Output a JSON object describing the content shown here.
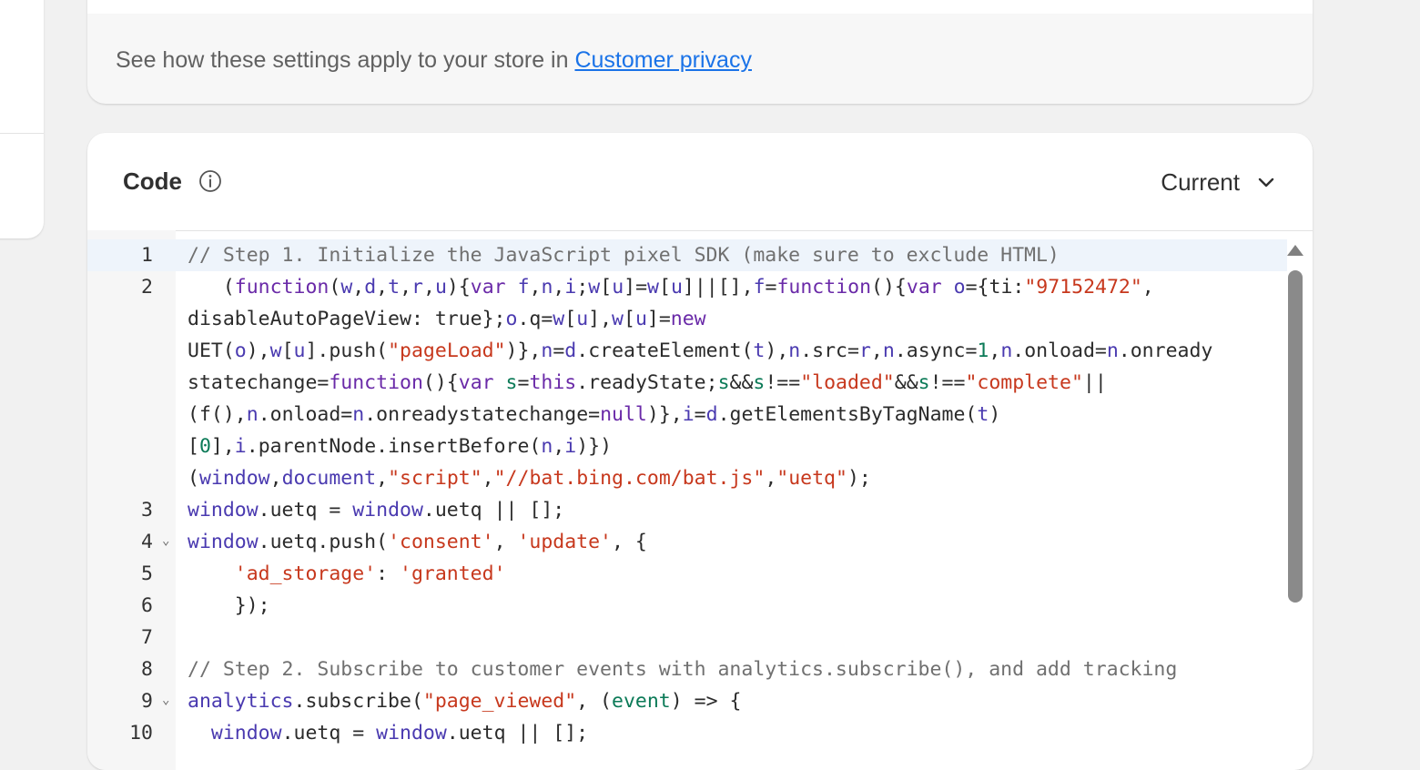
{
  "privacy": {
    "text": "See how these settings apply to your store in ",
    "link": "Customer privacy"
  },
  "code_card": {
    "title": "Code",
    "version": "Current"
  },
  "colors": {
    "link": "#1a73e8",
    "string": "#c7381d",
    "keyword": "#6a2aa8",
    "comment": "#707070"
  },
  "code_lines": [
    {
      "n": "1",
      "fold": false,
      "tokens": [
        [
          "c",
          "// Step 1. Initialize the JavaScript pixel SDK (make sure to exclude HTML)"
        ]
      ]
    },
    {
      "n": "2",
      "fold": false,
      "tokens": [
        [
          "p",
          "   ("
        ],
        [
          "k",
          "function"
        ],
        [
          "p",
          "("
        ],
        [
          "v",
          "w"
        ],
        [
          "p",
          ","
        ],
        [
          "v",
          "d"
        ],
        [
          "p",
          ","
        ],
        [
          "v",
          "t"
        ],
        [
          "p",
          ","
        ],
        [
          "v",
          "r"
        ],
        [
          "p",
          ","
        ],
        [
          "v",
          "u"
        ],
        [
          "p",
          "){"
        ],
        [
          "k",
          "var "
        ],
        [
          "v",
          "f"
        ],
        [
          "p",
          ","
        ],
        [
          "v",
          "n"
        ],
        [
          "p",
          ","
        ],
        [
          "v",
          "i"
        ],
        [
          "p",
          ";"
        ],
        [
          "v",
          "w"
        ],
        [
          "p",
          "["
        ],
        [
          "v",
          "u"
        ],
        [
          "p",
          "]="
        ],
        [
          "v",
          "w"
        ],
        [
          "p",
          "["
        ],
        [
          "v",
          "u"
        ],
        [
          "p",
          "]||[],"
        ],
        [
          "v",
          "f"
        ],
        [
          "p",
          "="
        ],
        [
          "k",
          "function"
        ],
        [
          "p",
          "(){"
        ],
        [
          "k",
          "var "
        ],
        [
          "v",
          "o"
        ],
        [
          "p",
          "={ti:"
        ],
        [
          "s",
          "\"97152472\""
        ],
        [
          "p",
          ",\ndisableAutoPageView: true};"
        ],
        [
          "v",
          "o"
        ],
        [
          "p",
          ".q="
        ],
        [
          "v",
          "w"
        ],
        [
          "p",
          "["
        ],
        [
          "v",
          "u"
        ],
        [
          "p",
          "],"
        ],
        [
          "v",
          "w"
        ],
        [
          "p",
          "["
        ],
        [
          "v",
          "u"
        ],
        [
          "p",
          "]="
        ],
        [
          "k",
          "new\n"
        ],
        [
          "p",
          "UET("
        ],
        [
          "v",
          "o"
        ],
        [
          "p",
          "),"
        ],
        [
          "v",
          "w"
        ],
        [
          "p",
          "["
        ],
        [
          "v",
          "u"
        ],
        [
          "p",
          "].push("
        ],
        [
          "s",
          "\"pageLoad\""
        ],
        [
          "p",
          ")},"
        ],
        [
          "v",
          "n"
        ],
        [
          "p",
          "="
        ],
        [
          "v",
          "d"
        ],
        [
          "p",
          ".createElement("
        ],
        [
          "v",
          "t"
        ],
        [
          "p",
          "),"
        ],
        [
          "v",
          "n"
        ],
        [
          "p",
          ".src="
        ],
        [
          "v",
          "r"
        ],
        [
          "p",
          ","
        ],
        [
          "v",
          "n"
        ],
        [
          "p",
          ".async="
        ],
        [
          "n",
          "1"
        ],
        [
          "p",
          ","
        ],
        [
          "v",
          "n"
        ],
        [
          "p",
          ".onload="
        ],
        [
          "v",
          "n"
        ],
        [
          "p",
          ".onready\nstatechange="
        ],
        [
          "k",
          "function"
        ],
        [
          "p",
          "(){"
        ],
        [
          "k",
          "var "
        ],
        [
          "n",
          "s"
        ],
        [
          "p",
          "="
        ],
        [
          "k",
          "this"
        ],
        [
          "p",
          ".readyState;"
        ],
        [
          "n",
          "s"
        ],
        [
          "p",
          "&&"
        ],
        [
          "n",
          "s"
        ],
        [
          "p",
          "!=="
        ],
        [
          "s",
          "\"loaded\""
        ],
        [
          "p",
          "&&"
        ],
        [
          "n",
          "s"
        ],
        [
          "p",
          "!=="
        ],
        [
          "s",
          "\"complete\""
        ],
        [
          "p",
          "||\n(f(),"
        ],
        [
          "v",
          "n"
        ],
        [
          "p",
          ".onload="
        ],
        [
          "v",
          "n"
        ],
        [
          "p",
          ".onreadystatechange="
        ],
        [
          "k",
          "null"
        ],
        [
          "p",
          ")},"
        ],
        [
          "v",
          "i"
        ],
        [
          "p",
          "="
        ],
        [
          "v",
          "d"
        ],
        [
          "p",
          ".getElementsByTagName("
        ],
        [
          "v",
          "t"
        ],
        [
          "p",
          ")\n["
        ],
        [
          "n",
          "0"
        ],
        [
          "p",
          "],"
        ],
        [
          "v",
          "i"
        ],
        [
          "p",
          ".parentNode.insertBefore("
        ],
        [
          "v",
          "n"
        ],
        [
          "p",
          ","
        ],
        [
          "v",
          "i"
        ],
        [
          "p",
          ")})\n("
        ],
        [
          "v",
          "window"
        ],
        [
          "p",
          ","
        ],
        [
          "v",
          "document"
        ],
        [
          "p",
          ","
        ],
        [
          "s",
          "\"script\""
        ],
        [
          "p",
          ","
        ],
        [
          "s",
          "\"//bat.bing.com/bat.js\""
        ],
        [
          "p",
          ","
        ],
        [
          "s",
          "\"uetq\""
        ],
        [
          "p",
          ");"
        ]
      ]
    },
    {
      "n": "3",
      "fold": false,
      "tokens": [
        [
          "v",
          "window"
        ],
        [
          "p",
          ".uetq = "
        ],
        [
          "v",
          "window"
        ],
        [
          "p",
          ".uetq || [];"
        ]
      ]
    },
    {
      "n": "4",
      "fold": true,
      "tokens": [
        [
          "v",
          "window"
        ],
        [
          "p",
          ".uetq.push("
        ],
        [
          "s",
          "'consent'"
        ],
        [
          "p",
          ", "
        ],
        [
          "s",
          "'update'"
        ],
        [
          "p",
          ", {"
        ]
      ]
    },
    {
      "n": "5",
      "fold": false,
      "tokens": [
        [
          "p",
          "    "
        ],
        [
          "s",
          "'ad_storage'"
        ],
        [
          "p",
          ": "
        ],
        [
          "s",
          "'granted'"
        ]
      ]
    },
    {
      "n": "6",
      "fold": false,
      "tokens": [
        [
          "p",
          "    });"
        ]
      ]
    },
    {
      "n": "7",
      "fold": false,
      "tokens": [
        [
          "p",
          " "
        ]
      ]
    },
    {
      "n": "8",
      "fold": false,
      "tokens": [
        [
          "c",
          "// Step 2. Subscribe to customer events with analytics.subscribe(), and add tracking"
        ]
      ]
    },
    {
      "n": "9",
      "fold": true,
      "tokens": [
        [
          "v",
          "analytics"
        ],
        [
          "p",
          ".subscribe("
        ],
        [
          "s",
          "\"page_viewed\""
        ],
        [
          "p",
          ", ("
        ],
        [
          "n",
          "event"
        ],
        [
          "p",
          ") => {"
        ]
      ]
    },
    {
      "n": "10",
      "fold": false,
      "tokens": [
        [
          "p",
          "  "
        ],
        [
          "v",
          "window"
        ],
        [
          "p",
          ".uetq = "
        ],
        [
          "v",
          "window"
        ],
        [
          "p",
          ".uetq || [];"
        ]
      ]
    }
  ]
}
